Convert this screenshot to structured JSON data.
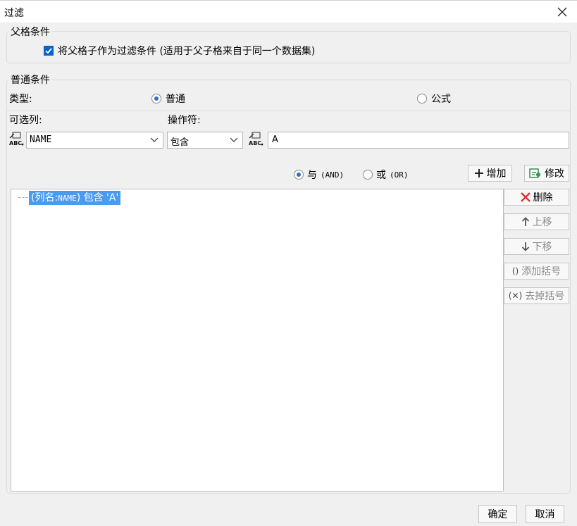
{
  "window": {
    "title": "过滤"
  },
  "parent_condition": {
    "legend": "父格条件",
    "checkbox_label": "将父格子作为过滤条件 (适用于父子格来自于同一个数据集)",
    "checked": true
  },
  "normal_condition": {
    "legend": "普通条件",
    "type_label": "类型:",
    "type_options": [
      "普通",
      "公式"
    ],
    "type_selected": "普通",
    "column_label": "可选列:",
    "operator_label": "操作符:",
    "column_value": "NAME",
    "operator_value": "包含",
    "value_text": "A"
  },
  "logic": {
    "and_label": "与",
    "and_code": "(AND)",
    "or_label": "或",
    "or_code": "(OR)",
    "selected": "and"
  },
  "actions": {
    "add": "增加",
    "modify": "修改",
    "delete": "删除",
    "move_up": "上移",
    "move_down": "下移",
    "add_bracket": "添加括号",
    "remove_bracket": "去掉括号"
  },
  "conditions": [
    {
      "prefix": "(列名:",
      "column": "NAME",
      "mid": ") 包含 '",
      "value": "A",
      "suffix": "'"
    }
  ],
  "footer": {
    "ok": "确定",
    "cancel": "取消"
  },
  "colors": {
    "accent": "#0a64c8",
    "selection": "#4a9af0",
    "delete_red": "#e03030"
  }
}
